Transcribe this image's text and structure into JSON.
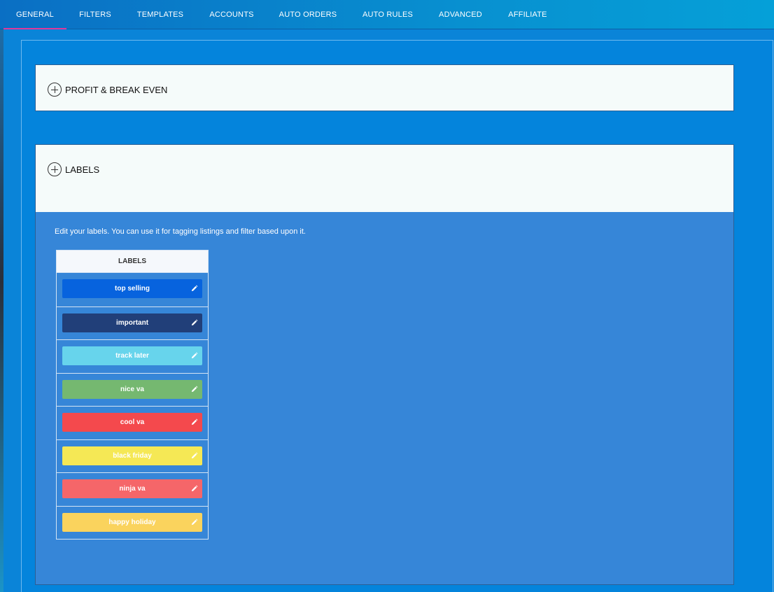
{
  "tabs": [
    {
      "label": "GENERAL",
      "active": true
    },
    {
      "label": "FILTERS",
      "active": false
    },
    {
      "label": "TEMPLATES",
      "active": false
    },
    {
      "label": "ACCOUNTS",
      "active": false
    },
    {
      "label": "AUTO ORDERS",
      "active": false
    },
    {
      "label": "AUTO RULES",
      "active": false
    },
    {
      "label": "ADVANCED",
      "active": false
    },
    {
      "label": "AFFILIATE",
      "active": false
    }
  ],
  "sections": {
    "profit": {
      "title": "PROFIT & BREAK EVEN",
      "icon": "plus-circle-icon"
    },
    "labels": {
      "title": "LABELS",
      "icon": "plus-circle-icon",
      "description": "Edit your labels. You can use it for tagging listings and filter based upon it.",
      "table_header": "LABELS",
      "items": [
        {
          "name": "top selling",
          "color": "#0763de"
        },
        {
          "name": "important",
          "color": "#213f79"
        },
        {
          "name": "track later",
          "color": "#67d4ec"
        },
        {
          "name": "nice va",
          "color": "#75b870"
        },
        {
          "name": "cool va",
          "color": "#f4494d"
        },
        {
          "name": "black friday",
          "color": "#f5e855"
        },
        {
          "name": "ninja va",
          "color": "#f56669"
        },
        {
          "name": "happy holiday",
          "color": "#fad35d"
        }
      ]
    }
  },
  "colors": {
    "accent_tab_underline": "#e0389a",
    "panel_blue": "#3686d8"
  }
}
